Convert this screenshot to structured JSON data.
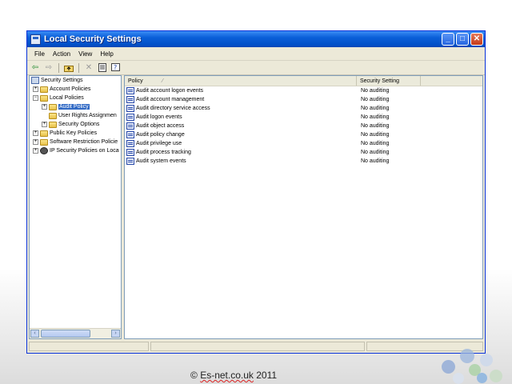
{
  "window": {
    "title": "Local Security Settings",
    "controls": {
      "minimize": "_",
      "maximize": "□",
      "close": "✕"
    }
  },
  "menubar": [
    "File",
    "Action",
    "View",
    "Help"
  ],
  "toolbar": {
    "icons": [
      "back-arrow-icon",
      "forward-arrow-icon",
      "up-folder-icon",
      "delete-icon",
      "properties-icon",
      "help-icon"
    ]
  },
  "tree": {
    "root": "Security Settings",
    "items": [
      {
        "label": "Account Policies",
        "expander": "+",
        "level": 1
      },
      {
        "label": "Local Policies",
        "expander": "−",
        "level": 1
      },
      {
        "label": "Audit Policy",
        "expander": "+",
        "level": 2,
        "selected": true
      },
      {
        "label": "User Rights Assignmen",
        "expander": "",
        "level": 2
      },
      {
        "label": "Security Options",
        "expander": "+",
        "level": 2
      },
      {
        "label": "Public Key Policies",
        "expander": "+",
        "level": 1
      },
      {
        "label": "Software Restriction Policie",
        "expander": "+",
        "level": 1
      },
      {
        "label": "IP Security Policies on Loca",
        "expander": "+",
        "level": 1
      }
    ]
  },
  "list": {
    "columns": {
      "policy": "Policy",
      "sort_indicator": "⁄",
      "setting": "Security Setting"
    },
    "rows": [
      {
        "policy": "Audit account logon events",
        "setting": "No auditing"
      },
      {
        "policy": "Audit account management",
        "setting": "No auditing"
      },
      {
        "policy": "Audit directory service access",
        "setting": "No auditing"
      },
      {
        "policy": "Audit logon events",
        "setting": "No auditing"
      },
      {
        "policy": "Audit object access",
        "setting": "No auditing"
      },
      {
        "policy": "Audit policy change",
        "setting": "No auditing"
      },
      {
        "policy": "Audit privilege use",
        "setting": "No auditing"
      },
      {
        "policy": "Audit process tracking",
        "setting": "No auditing"
      },
      {
        "policy": "Audit system events",
        "setting": "No auditing"
      }
    ]
  },
  "footer": {
    "prefix": "© ",
    "brand": "Es-net.co.uk",
    "year": " 2011"
  },
  "colors": {
    "titlebar": "#0a5fd8",
    "selection": "#316ac5",
    "window_bg": "#ece9d8"
  }
}
